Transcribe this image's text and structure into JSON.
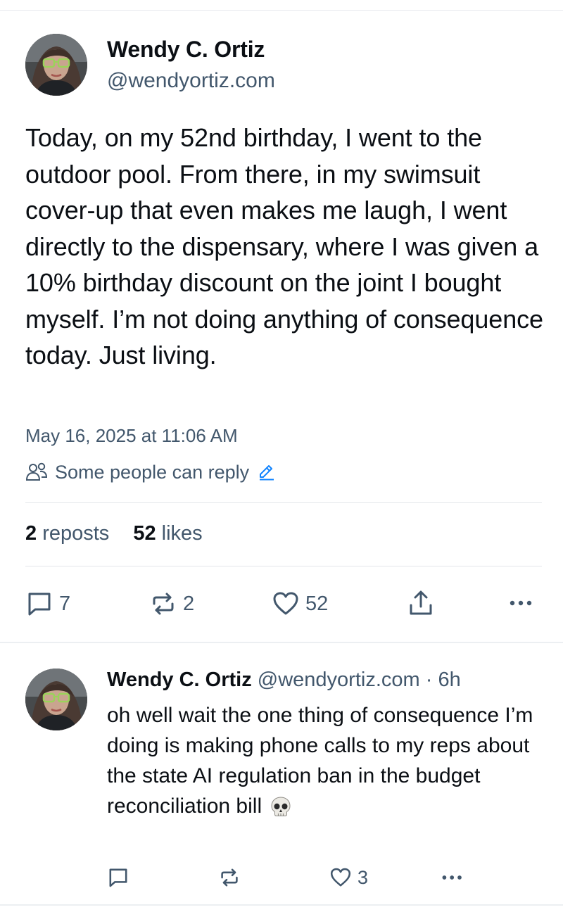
{
  "post": {
    "author_name": "Wendy C. Ortiz",
    "author_handle": "@wendyortiz.com",
    "text": "Today, on my 52nd birthday, I went to the outdoor pool. From there, in my swimsuit cover-up that even makes me laugh, I went directly to the dispensary, where I was given a 10% birthday discount on the joint I bought myself. I’m not doing anything of consequence today. Just living.",
    "timestamp": "May 16, 2025 at 11:06 AM",
    "reply_setting": "Some people can reply",
    "reposts_count": "2",
    "reposts_label": "reposts",
    "likes_count": "52",
    "likes_label": "likes",
    "actions": {
      "reply_count": "7",
      "repost_count": "2",
      "like_count": "52"
    }
  },
  "reply": {
    "author_name": "Wendy C. Ortiz",
    "author_handle": "@wendyortiz.com",
    "separator": "·",
    "time": "6h",
    "text": "oh well wait the one thing of consequence I’m doing is making phone calls to my reps about the state AI regulation ban in the budget reconciliation bill",
    "emoji": "skull-emoji",
    "actions": {
      "like_count": "3"
    }
  },
  "icons": [
    "people-icon",
    "pencil-icon",
    "comment-icon",
    "repost-icon",
    "heart-icon",
    "share-icon",
    "more-icon",
    "skull-icon"
  ],
  "colors": {
    "text": "#0b0f14",
    "muted": "#42576c",
    "accent": "#1083fe",
    "divider": "#e3e6ea"
  }
}
